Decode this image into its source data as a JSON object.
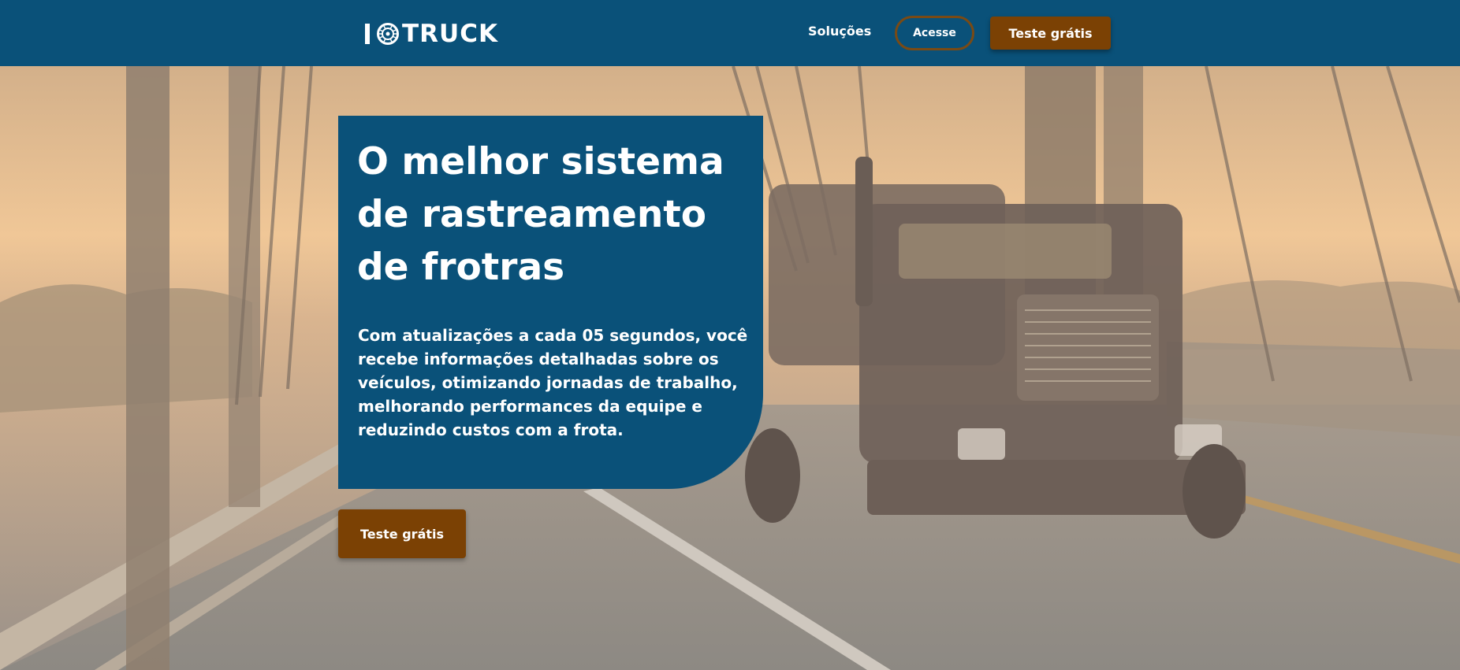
{
  "header": {
    "logo_text": "TRUCK",
    "nav": {
      "solucoes": "Soluções"
    },
    "acesse_label": "Acesse",
    "teste_label": "Teste grátis"
  },
  "hero": {
    "headline": "O melhor sistema de rastreamento de frotras",
    "subtext": "Com atualizações a cada 05 segundos, você recebe informações detalhadas sobre os veículos, otimizando jornadas de trabalho, melhorando performances da equipe e reduzindo custos com a frota.",
    "cta_label": "Teste grátis",
    "background": "truck-on-bridge-photo"
  },
  "colors": {
    "brand_blue": "#0a5179",
    "brand_brown": "#7b4104",
    "outline_brown": "#7a4a14"
  },
  "icons": [
    "tire-icon"
  ]
}
